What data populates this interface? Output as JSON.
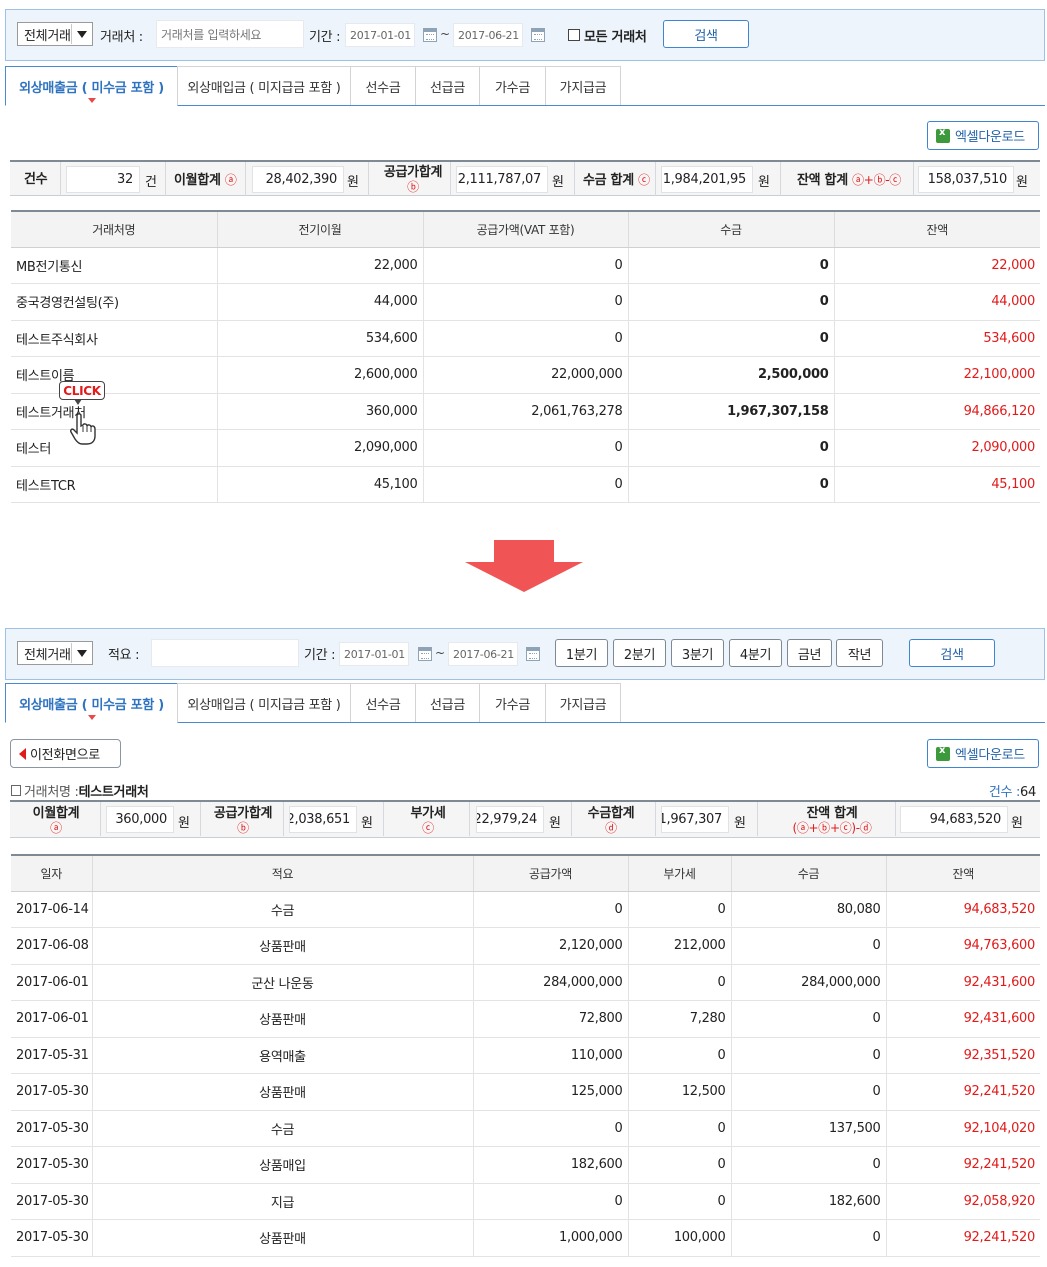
{
  "top": {
    "filter": {
      "type_select": "전체거래",
      "partner_label": "거래처 :",
      "partner_placeholder": "거래처를 입력하세요",
      "period_label": "기간 :",
      "date_from": "2017-01-01",
      "tilde": "~",
      "date_to": "2017-06-21",
      "all_partners_label": "모든 거래처",
      "search_label": "검색"
    },
    "tabs": [
      "외상매출금 ( 미수금 포함 )",
      "외상매입금 ( 미지급금 포함 )",
      "선수금",
      "선급금",
      "가수금",
      "가지급금"
    ],
    "excel_label": "엑셀다운로드",
    "summary": {
      "count_label": "건수",
      "count_value": "32",
      "count_unit": "건",
      "carry_label": "이월합계",
      "carry_mark": "ⓐ",
      "carry_value": "28,402,390",
      "supply_label": "공급가합계",
      "supply_mark": "ⓑ",
      "supply_value": "2,111,787,07",
      "receipt_label": "수금 합계",
      "receipt_mark": "ⓒ",
      "receipt_value": "1,984,201,95",
      "balance_label": "잔액 합계",
      "balance_mark": "ⓐ+ⓑ-ⓒ",
      "balance_value": "158,037,510",
      "won": "원"
    },
    "table": {
      "headers": [
        "거래처명",
        "전기이월",
        "공급가액(VAT 포함)",
        "수금",
        "잔액"
      ],
      "rows": [
        [
          "MB전기통신",
          "22,000",
          "0",
          "0",
          "22,000"
        ],
        [
          "중국경영컨설팅(주)",
          "44,000",
          "0",
          "0",
          "44,000"
        ],
        [
          "테스트주식회사",
          "534,600",
          "0",
          "0",
          "534,600"
        ],
        [
          "테스트이름",
          "2,600,000",
          "22,000,000",
          "2,500,000",
          "22,100,000"
        ],
        [
          "테스트거래처",
          "360,000",
          "2,061,763,278",
          "1,967,307,158",
          "94,866,120"
        ],
        [
          "테스터",
          "2,090,000",
          "0",
          "0",
          "2,090,000"
        ],
        [
          "테스트TCR",
          "45,100",
          "0",
          "0",
          "45,100"
        ]
      ]
    },
    "click_badge": "CLICK"
  },
  "bottom": {
    "filter": {
      "type_select": "전체거래",
      "memo_label": "적요 :",
      "period_label": "기간 :",
      "date_from": "2017-01-01",
      "tilde": "~",
      "date_to": "2017-06-21",
      "quarters": [
        "1분기",
        "2분기",
        "3분기",
        "4분기",
        "금년",
        "작년"
      ],
      "search_label": "검색"
    },
    "tabs": [
      "외상매출금 ( 미수금 포함 )",
      "외상매입금 ( 미지급금 포함 )",
      "선수금",
      "선급금",
      "가수금",
      "가지급금"
    ],
    "back_label": "이전화면으로",
    "excel_label": "엑셀다운로드",
    "partner_label": "거래처명 :",
    "partner_name": "테스트거래처",
    "count_label": "건수 :",
    "count_value": "64",
    "summary": {
      "carry_label": "이월합계",
      "carry_mark": "ⓐ",
      "carry_value": "360,000",
      "supply_label": "공급가합계",
      "supply_mark": "ⓑ",
      "supply_value": "2,038,651",
      "vat_label": "부가세",
      "vat_mark": "ⓒ",
      "vat_value": "22,979,24",
      "receipt_label": "수금합계",
      "receipt_mark": "ⓓ",
      "receipt_value": "1,967,307",
      "balance_label": "잔액 합계",
      "balance_mark": "(ⓐ+ⓑ+ⓒ)-ⓓ",
      "balance_value": "94,683,520",
      "won": "원"
    },
    "table": {
      "headers": [
        "일자",
        "적요",
        "공급가액",
        "부가세",
        "수금",
        "잔액"
      ],
      "rows": [
        [
          "2017-06-14",
          "수금",
          "0",
          "0",
          "80,080",
          "94,683,520"
        ],
        [
          "2017-06-08",
          "상품판매",
          "2,120,000",
          "212,000",
          "0",
          "94,763,600"
        ],
        [
          "2017-06-01",
          "군산 나운동",
          "284,000,000",
          "0",
          "284,000,000",
          "92,431,600"
        ],
        [
          "2017-06-01",
          "상품판매",
          "72,800",
          "7,280",
          "0",
          "92,431,600"
        ],
        [
          "2017-05-31",
          "용역매출",
          "110,000",
          "0",
          "0",
          "92,351,520"
        ],
        [
          "2017-05-30",
          "상품판매",
          "125,000",
          "12,500",
          "0",
          "92,241,520"
        ],
        [
          "2017-05-30",
          "수금",
          "0",
          "0",
          "137,500",
          "92,104,020"
        ],
        [
          "2017-05-30",
          "상품매입",
          "182,600",
          "0",
          "0",
          "92,241,520"
        ],
        [
          "2017-05-30",
          "지급",
          "0",
          "0",
          "182,600",
          "92,058,920"
        ],
        [
          "2017-05-30",
          "상품판매",
          "1,000,000",
          "100,000",
          "0",
          "92,241,520"
        ]
      ]
    }
  },
  "colors": {
    "accent": "#2f73c0",
    "border_blue": "#9ec2e6",
    "negative_red": "#e21a1a",
    "arrow": "#f05454"
  }
}
